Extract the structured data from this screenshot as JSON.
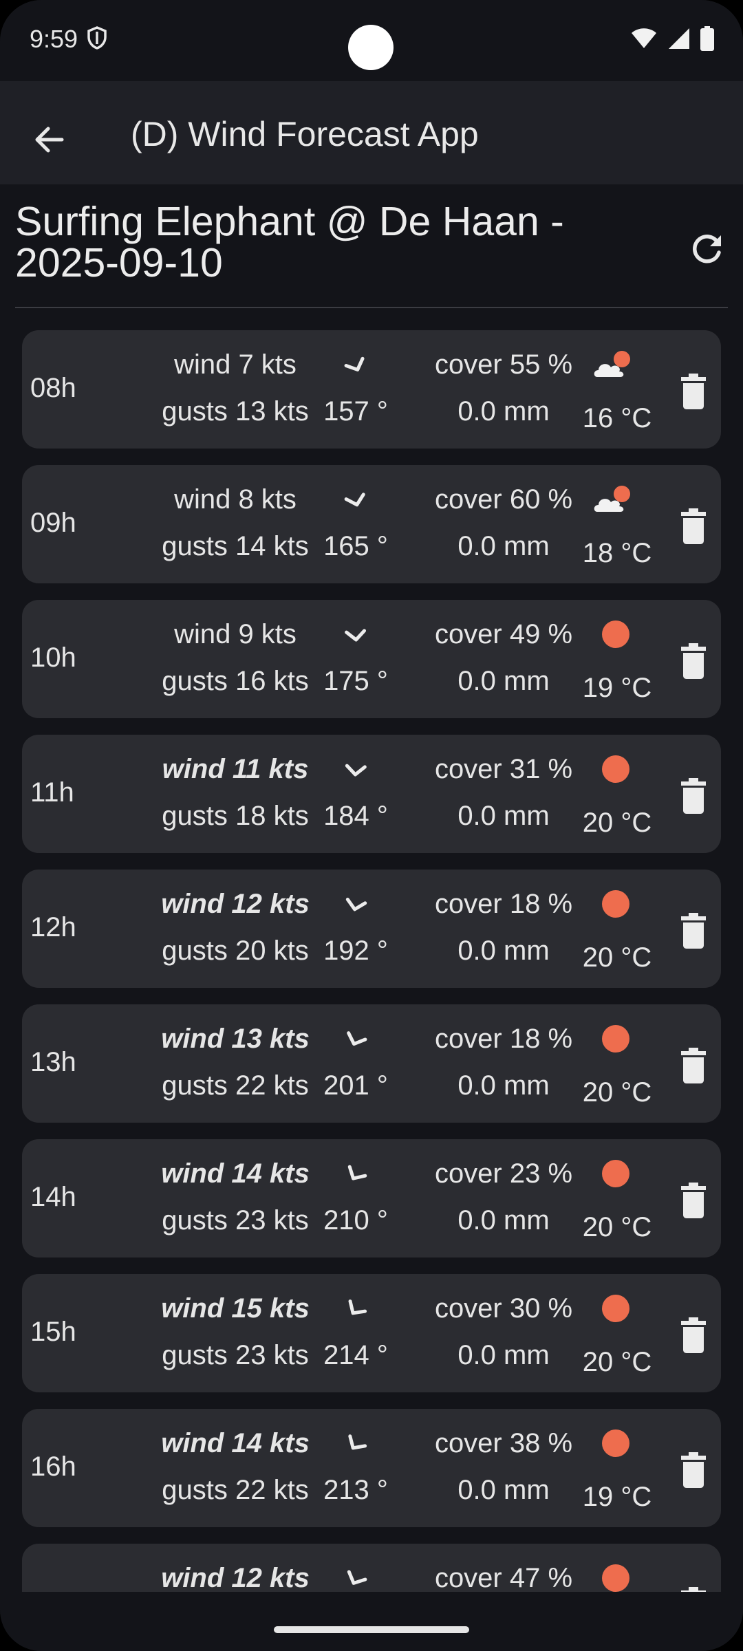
{
  "status": {
    "time": "9:59"
  },
  "app_bar": {
    "title": "(D) Wind Forecast App"
  },
  "header": {
    "title": "Surfing Elephant @ De Haan - 2025-09-10"
  },
  "colors": {
    "sun": "#ee6d4e",
    "cloud": "#f2f2f2",
    "card": "#2b2c31"
  },
  "rows": [
    {
      "hour": "08h",
      "wind": "wind 7 kts",
      "gusts": "gusts 13 kts",
      "direction": "157 °",
      "dir_deg": 157,
      "cover": "cover 55 %",
      "rain": "0.0 mm",
      "temp": "16 °C",
      "sky_icon": "partly-cloudy-icon",
      "strong": false
    },
    {
      "hour": "09h",
      "wind": "wind 8 kts",
      "gusts": "gusts 14 kts",
      "direction": "165 °",
      "dir_deg": 165,
      "cover": "cover 60 %",
      "rain": "0.0 mm",
      "temp": "18 °C",
      "sky_icon": "partly-cloudy-icon",
      "strong": false
    },
    {
      "hour": "10h",
      "wind": "wind 9 kts",
      "gusts": "gusts 16 kts",
      "direction": "175 °",
      "dir_deg": 175,
      "cover": "cover 49 %",
      "rain": "0.0 mm",
      "temp": "19 °C",
      "sky_icon": "sun-icon",
      "strong": false
    },
    {
      "hour": "11h",
      "wind": "wind 11 kts",
      "gusts": "gusts 18 kts",
      "direction": "184 °",
      "dir_deg": 184,
      "cover": "cover 31 %",
      "rain": "0.0 mm",
      "temp": "20 °C",
      "sky_icon": "sun-icon",
      "strong": true
    },
    {
      "hour": "12h",
      "wind": "wind 12 kts",
      "gusts": "gusts 20 kts",
      "direction": "192 °",
      "dir_deg": 192,
      "cover": "cover 18 %",
      "rain": "0.0 mm",
      "temp": "20 °C",
      "sky_icon": "sun-icon",
      "strong": true
    },
    {
      "hour": "13h",
      "wind": "wind 13 kts",
      "gusts": "gusts 22 kts",
      "direction": "201 °",
      "dir_deg": 201,
      "cover": "cover 18 %",
      "rain": "0.0 mm",
      "temp": "20 °C",
      "sky_icon": "sun-icon",
      "strong": true
    },
    {
      "hour": "14h",
      "wind": "wind 14 kts",
      "gusts": "gusts 23 kts",
      "direction": "210 °",
      "dir_deg": 210,
      "cover": "cover 23 %",
      "rain": "0.0 mm",
      "temp": "20 °C",
      "sky_icon": "sun-icon",
      "strong": true
    },
    {
      "hour": "15h",
      "wind": "wind 15 kts",
      "gusts": "gusts 23 kts",
      "direction": "214 °",
      "dir_deg": 214,
      "cover": "cover 30 %",
      "rain": "0.0 mm",
      "temp": "20 °C",
      "sky_icon": "sun-icon",
      "strong": true
    },
    {
      "hour": "16h",
      "wind": "wind 14 kts",
      "gusts": "gusts 22 kts",
      "direction": "213 °",
      "dir_deg": 213,
      "cover": "cover 38 %",
      "rain": "0.0 mm",
      "temp": "19 °C",
      "sky_icon": "sun-icon",
      "strong": true
    },
    {
      "hour": "",
      "wind": "wind 12 kts",
      "gusts": "",
      "direction": "",
      "dir_deg": 205,
      "cover": "cover 47 %",
      "rain": "",
      "temp": "",
      "sky_icon": "sun-icon",
      "strong": true
    }
  ]
}
